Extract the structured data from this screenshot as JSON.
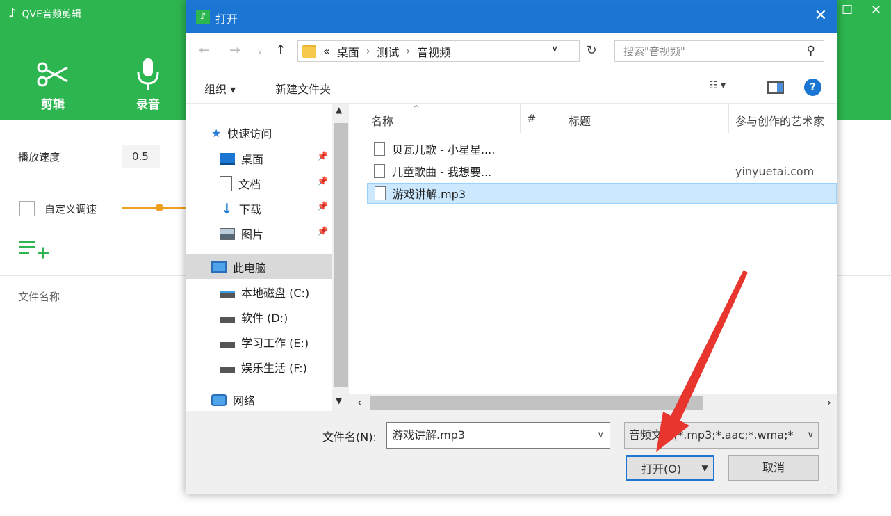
{
  "app": {
    "title": "QVE音频剪辑",
    "tools": [
      {
        "label": "剪辑"
      },
      {
        "label": "录音"
      }
    ],
    "speed_label": "播放速度",
    "speed_value": "0.5",
    "custom_speed_label": "自定义调速",
    "file_name_header": "文件名称"
  },
  "dialog": {
    "title": "打开",
    "breadcrumb": [
      "«",
      "桌面",
      "测试",
      "音视频"
    ],
    "search_placeholder": "搜索\"音视频\"",
    "toolbar": {
      "organize": "组织 ▾",
      "new_folder": "新建文件夹"
    },
    "nav": {
      "quick_access": "快速访问",
      "desktop": "桌面",
      "documents": "文档",
      "downloads": "下载",
      "pictures": "图片",
      "this_pc": "此电脑",
      "drive_c": "本地磁盘 (C:)",
      "drive_d": "软件 (D:)",
      "drive_e": "学习工作 (E:)",
      "drive_f": "娱乐生活 (F:)",
      "network": "网络"
    },
    "columns": {
      "name": "名称",
      "number": "#",
      "title": "标题",
      "artist": "参与创作的艺术家"
    },
    "files": [
      {
        "name": "贝瓦儿歌 - 小星星....",
        "artist": ""
      },
      {
        "name": "儿童歌曲 - 我想要...",
        "artist": "yinyuetai.com"
      },
      {
        "name": "游戏讲解.mp3",
        "artist": ""
      }
    ],
    "filename_label": "文件名(N):",
    "filename_value": "游戏讲解.mp3",
    "filetype_value": "音频文件(*.mp3;*.aac;*.wma;*",
    "open_button": "打开(O)",
    "cancel_button": "取消"
  },
  "colors": {
    "app_green": "#2db54f",
    "dialog_blue": "#1a76d2",
    "selection": "#cce8ff",
    "annotation_red": "#e8362e"
  }
}
